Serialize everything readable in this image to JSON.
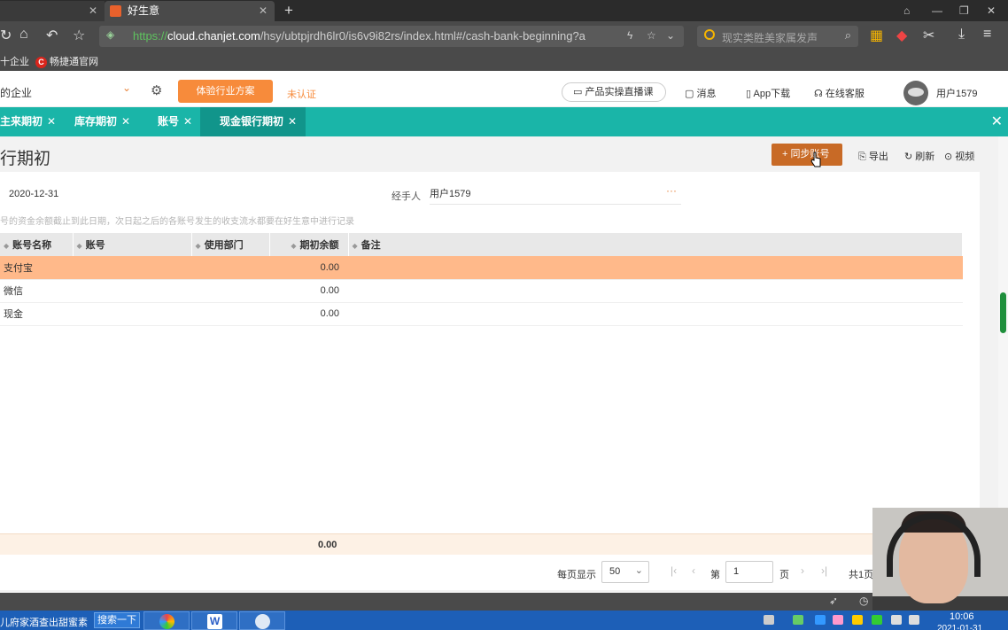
{
  "browser": {
    "tab1_title": "",
    "tab2_title": "好生意",
    "tab_close": "✕",
    "new_tab": "+",
    "url_https": "https://",
    "url_host": "cloud.chanjet.com",
    "url_path": "/hsy/ubtpjrdh6lr0/is6v9i82rs/index.html#/cash-bank-beginning?a",
    "search_placeholder": "现实类胜美家属发声",
    "bookmark1": "十企业",
    "bookmark2": "畅捷通官网",
    "bookmark2_icon_text": "C"
  },
  "header": {
    "company": "的企业",
    "trial_button": "体验行业方案",
    "uncertified": "未认证",
    "live_button": "产品实操直播课",
    "messages": "消息",
    "app_download": "App下载",
    "support": "在线客服",
    "username": "用户1579"
  },
  "tabs": [
    {
      "label": "主来期初"
    },
    {
      "label": "库存期初"
    },
    {
      "label": "账号"
    },
    {
      "label": "现金银行期初"
    }
  ],
  "page": {
    "title": "行期初",
    "sync_button": "+ 同步账号",
    "export": "导出",
    "refresh": "刷新",
    "video": "视频",
    "date": "2020-12-31",
    "handler_label": "经手人",
    "handler_value": "用户1579",
    "more": "···",
    "hint": "号的资金余额截止到此日期，次日起之后的各账号发生的收支流水都要在好生意中进行记录"
  },
  "table": {
    "columns": [
      "账号名称",
      "账号",
      "使用部门",
      "期初余额",
      "备注"
    ],
    "rows": [
      [
        "支付宝",
        "",
        "",
        "0.00",
        ""
      ],
      [
        "微信",
        "",
        "",
        "0.00",
        ""
      ],
      [
        "现金",
        "",
        "",
        "0.00",
        ""
      ]
    ],
    "total": "0.00"
  },
  "pager": {
    "per_page_label": "每页显示",
    "per_page": "50",
    "page_prefix": "第",
    "page": "1",
    "page_suffix": "页",
    "total_pages": "共1页"
  },
  "taskbar": {
    "news": "儿府家酒查出甜蜜素",
    "search_button": "搜索一下",
    "time": "10:06",
    "date": "2021-01-31"
  }
}
